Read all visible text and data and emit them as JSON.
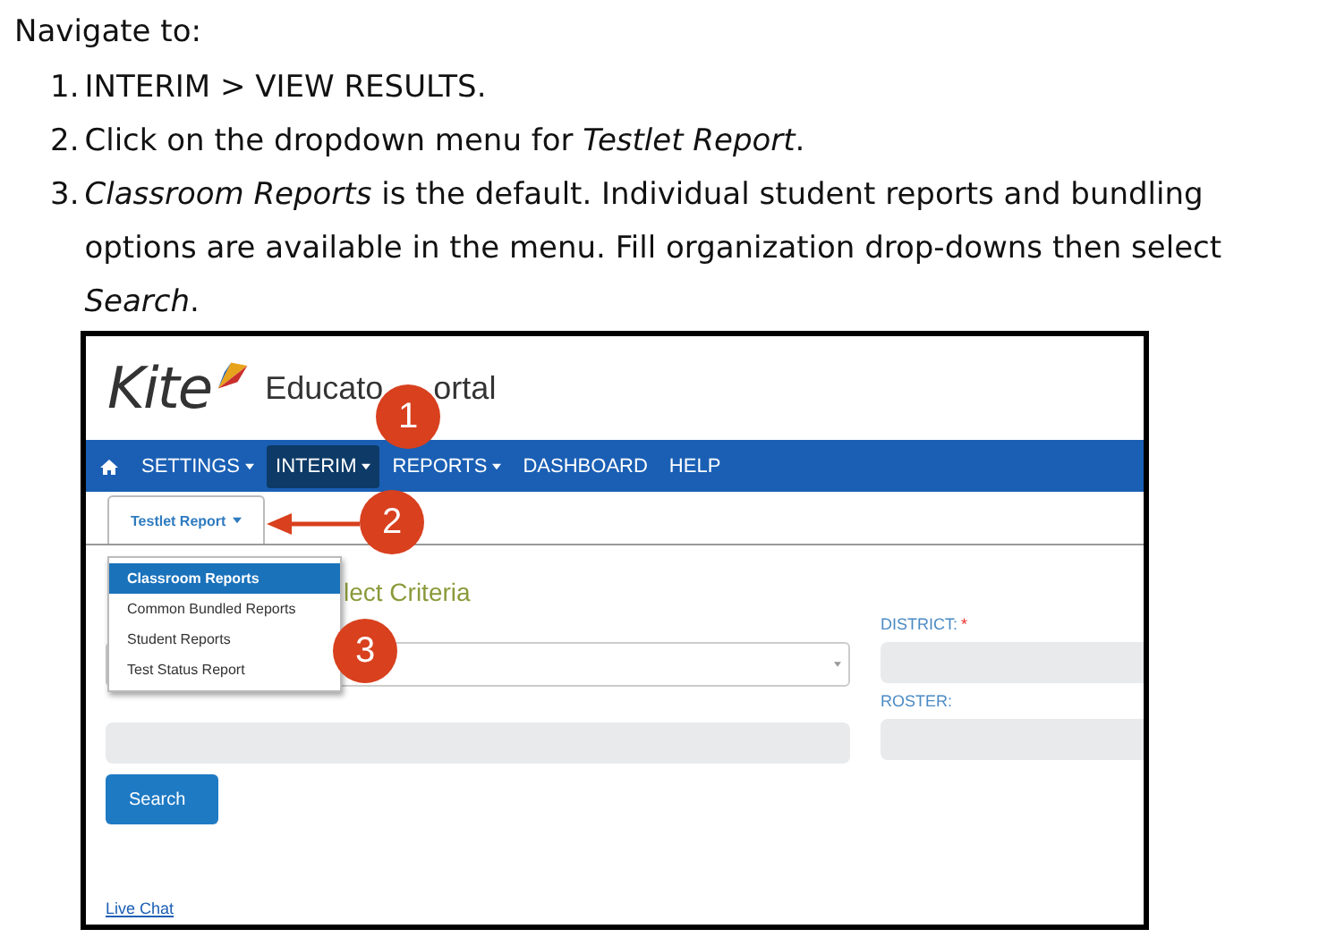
{
  "heading": "Navigate to:",
  "steps": [
    {
      "number": "1.",
      "text": "INTERIM > VIEW RESULTS."
    },
    {
      "number": "2.",
      "text": "Click on the dropdown menu for *Testlet Report*."
    },
    {
      "number": "3.",
      "text": "*Classroom Reports* is the default. Individual student reports and bundling options are available in the menu. Fill organization drop-downs then select *Search*."
    }
  ],
  "screenshot": {
    "logo": "Kite",
    "title_parts": [
      "Educato",
      "ortal"
    ],
    "nav": [
      {
        "label": "SETTINGS",
        "dropdown": true,
        "selected": false
      },
      {
        "label": "INTERIM",
        "dropdown": true,
        "selected": true
      },
      {
        "label": "REPORTS",
        "dropdown": true,
        "selected": false
      },
      {
        "label": "DASHBOARD",
        "dropdown": false,
        "selected": false
      },
      {
        "label": "HELP",
        "dropdown": false,
        "selected": false
      }
    ],
    "tab": {
      "label": "Testlet Report"
    },
    "menu": [
      {
        "label": "Classroom Reports",
        "selected": true
      },
      {
        "label": "Common Bundled Reports",
        "selected": false
      },
      {
        "label": "Student Reports",
        "selected": false
      },
      {
        "label": "Test Status Report",
        "selected": false
      }
    ],
    "section_title": "lect Criteria",
    "district_label": "DISTRICT:",
    "required_mark": "*",
    "roster_label": "ROSTER:",
    "search_button": "Search",
    "live_chat": "Live Chat",
    "callouts": [
      "1",
      "2",
      "3"
    ]
  }
}
